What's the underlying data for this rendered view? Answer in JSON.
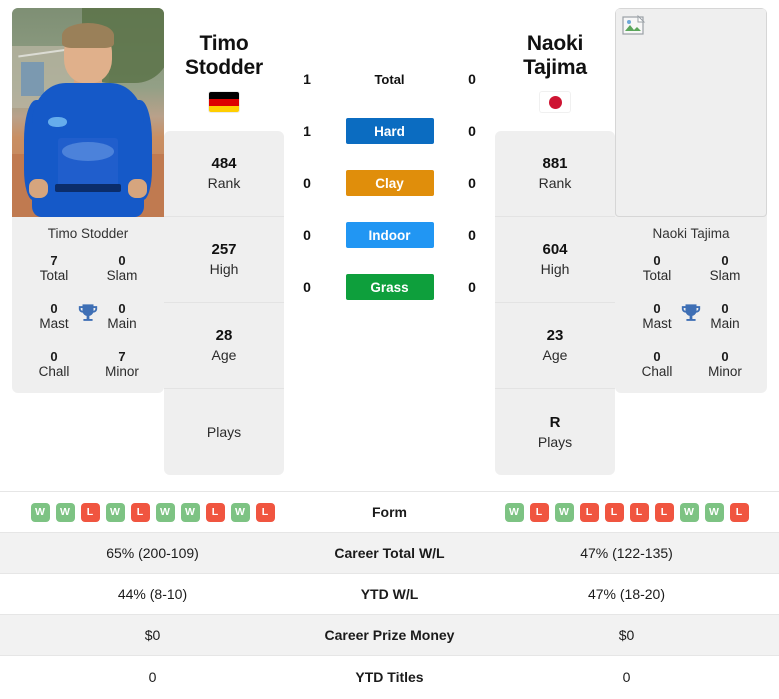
{
  "players": {
    "left": {
      "name_line1": "Timo",
      "name_line2": "Stodder",
      "full_name": "Timo Stodder",
      "photo_caption": "Timo Stodder",
      "country": "Germany",
      "flag_icon": "flag-de-icon",
      "flag_colors": [
        "#000000",
        "#DD0000",
        "#FFCE00"
      ],
      "metrics": [
        {
          "value": "484",
          "label": "Rank"
        },
        {
          "value": "257",
          "label": "High"
        },
        {
          "value": "28",
          "label": "Age"
        },
        {
          "value": "",
          "label": "Plays"
        }
      ],
      "titles": {
        "header": "Timo Stodder",
        "cells": [
          {
            "value": "7",
            "label": "Total"
          },
          {
            "value": "0",
            "label": "Slam"
          },
          {
            "value": "0",
            "label": "Mast"
          },
          {
            "value": "0",
            "label": "Main"
          },
          {
            "value": "0",
            "label": "Chall"
          },
          {
            "value": "7",
            "label": "Minor"
          }
        ]
      },
      "surface_counts": {
        "total": "1",
        "hard": "1",
        "clay": "0",
        "indoor": "0",
        "grass": "0"
      },
      "form": [
        "W",
        "W",
        "L",
        "W",
        "L",
        "W",
        "W",
        "L",
        "W",
        "L"
      ],
      "career_total_wl": "65% (200-109)",
      "ytd_wl": "44% (8-10)",
      "career_prize_money": "$0",
      "ytd_titles": "0"
    },
    "right": {
      "name_line1": "Naoki Tajima",
      "name_line2": "",
      "full_name": "Naoki Tajima",
      "photo_caption": "Naoki Tajima",
      "country": "Japan",
      "flag_icon": "flag-jp-icon",
      "flag_colors": [
        "#FFFFFF",
        "#CE1432"
      ],
      "photo_state": "broken-image",
      "broken_image_icon": "broken-image-icon",
      "metrics": [
        {
          "value": "881",
          "label": "Rank"
        },
        {
          "value": "604",
          "label": "High"
        },
        {
          "value": "23",
          "label": "Age"
        },
        {
          "value": "R",
          "label": "Plays"
        }
      ],
      "titles": {
        "header": "Naoki Tajima",
        "cells": [
          {
            "value": "0",
            "label": "Total"
          },
          {
            "value": "0",
            "label": "Slam"
          },
          {
            "value": "0",
            "label": "Mast"
          },
          {
            "value": "0",
            "label": "Main"
          },
          {
            "value": "0",
            "label": "Chall"
          },
          {
            "value": "0",
            "label": "Minor"
          }
        ]
      },
      "surface_counts": {
        "total": "0",
        "hard": "0",
        "clay": "0",
        "indoor": "0",
        "grass": "0"
      },
      "form": [
        "W",
        "L",
        "W",
        "L",
        "L",
        "L",
        "L",
        "W",
        "W",
        "L"
      ],
      "career_total_wl": "47% (122-135)",
      "ytd_wl": "47% (18-20)",
      "career_prize_money": "$0",
      "ytd_titles": "0"
    }
  },
  "surfaces": [
    {
      "key": "total",
      "label": "Total",
      "color": "transparent",
      "text_color": "#111111",
      "plain": true
    },
    {
      "key": "hard",
      "label": "Hard",
      "color": "#0B6CC1",
      "text_color": "#ffffff",
      "plain": false
    },
    {
      "key": "clay",
      "label": "Clay",
      "color": "#E08E0B",
      "text_color": "#ffffff",
      "plain": false
    },
    {
      "key": "indoor",
      "label": "Indoor",
      "color": "#2196F3",
      "text_color": "#ffffff",
      "plain": false
    },
    {
      "key": "grass",
      "label": "Grass",
      "color": "#0E9F3C",
      "text_color": "#ffffff",
      "plain": false
    }
  ],
  "trophy_icon": "trophy-icon",
  "trophy_color": "#3E6FB5",
  "comparison_rows": [
    {
      "label": "Form",
      "left": "",
      "right": "",
      "type": "form"
    },
    {
      "label": "Career Total W/L",
      "left": "65% (200-109)",
      "right": "47% (122-135)",
      "type": "text"
    },
    {
      "label": "YTD W/L",
      "left": "44% (8-10)",
      "right": "47% (18-20)",
      "type": "text"
    },
    {
      "label": "Career Prize Money",
      "left": "$0",
      "right": "$0",
      "type": "text"
    },
    {
      "label": "YTD Titles",
      "left": "0",
      "right": "0",
      "type": "text"
    }
  ],
  "form_badge_colors": {
    "win": "#7dc383",
    "loss": "#f05540"
  }
}
